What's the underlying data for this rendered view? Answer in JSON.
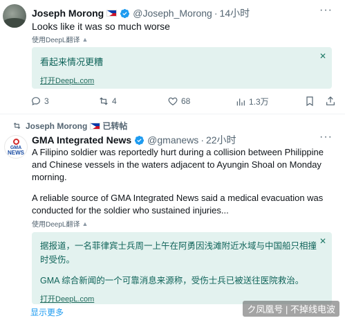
{
  "tweet1": {
    "name": "Joseph Morong",
    "handle": "@Joseph_Morong",
    "dot": "·",
    "time": "14小时",
    "more": "···",
    "text": "Looks like it was so much worse",
    "translate_label": "使用DeepL翻译",
    "translation_close": "✕",
    "translation_text": "看起来情况更糟",
    "translation_open": "打开DeepL.com",
    "actions": {
      "replies": "3",
      "retweets": "4",
      "likes": "68",
      "views": "1.3万"
    }
  },
  "tweet2": {
    "reposter": "Joseph Morong",
    "repost_label": "已转帖",
    "name": "GMA Integrated News",
    "handle": "@gmanews",
    "dot": "·",
    "time": "22小时",
    "more": "···",
    "avatar_text_top": "GMA",
    "avatar_text_bottom": "NEWS",
    "para1_line1": "A Filipino soldier was reportedly hurt during a collision between Philippine",
    "para1_line2": "and Chinese vessels in the waters adjacent to Ayungin Shoal on Monday",
    "para1_line3": "morning.",
    "para2_line1": "A reliable source of GMA Integrated News said a medical evacuation was",
    "para2_line2": "conducted for the soldier who sustained injuries...",
    "translate_label": "使用DeepL翻译",
    "translation_close": "✕",
    "translation_line1": "据报道，一名菲律宾士兵周一上午在阿勇因浅滩附近水域与中国船只相撞",
    "translation_line2": "时受伤。",
    "translation_line3": "GMA 综合新闻的一个可靠消息来源称，受伤士兵已被送往医院救治。",
    "translation_open": "打开DeepL.com",
    "show_more": "显示更多"
  },
  "watermark": "ク凤凰号 | 不掉线电波",
  "colors": {
    "verified": "#1d9bf0",
    "translation_bg": "#e3f2ef",
    "link": "#1d9bf0",
    "muted": "#536471"
  }
}
